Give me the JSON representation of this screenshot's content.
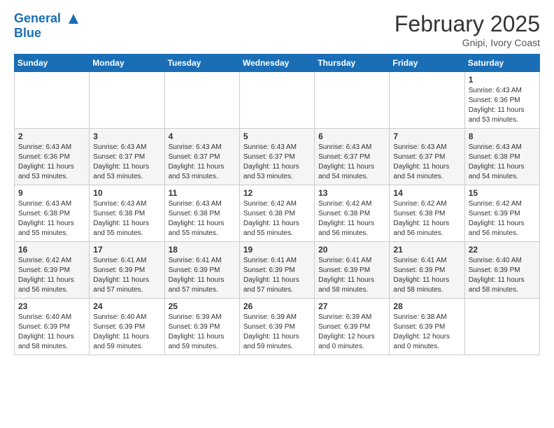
{
  "header": {
    "logo_line1": "General",
    "logo_line2": "Blue",
    "month_title": "February 2025",
    "location": "Gnipi, Ivory Coast"
  },
  "days_of_week": [
    "Sunday",
    "Monday",
    "Tuesday",
    "Wednesday",
    "Thursday",
    "Friday",
    "Saturday"
  ],
  "weeks": [
    [
      {
        "day": "",
        "info": ""
      },
      {
        "day": "",
        "info": ""
      },
      {
        "day": "",
        "info": ""
      },
      {
        "day": "",
        "info": ""
      },
      {
        "day": "",
        "info": ""
      },
      {
        "day": "",
        "info": ""
      },
      {
        "day": "1",
        "info": "Sunrise: 6:43 AM\nSunset: 6:36 PM\nDaylight: 11 hours\nand 53 minutes."
      }
    ],
    [
      {
        "day": "2",
        "info": "Sunrise: 6:43 AM\nSunset: 6:36 PM\nDaylight: 11 hours\nand 53 minutes."
      },
      {
        "day": "3",
        "info": "Sunrise: 6:43 AM\nSunset: 6:37 PM\nDaylight: 11 hours\nand 53 minutes."
      },
      {
        "day": "4",
        "info": "Sunrise: 6:43 AM\nSunset: 6:37 PM\nDaylight: 11 hours\nand 53 minutes."
      },
      {
        "day": "5",
        "info": "Sunrise: 6:43 AM\nSunset: 6:37 PM\nDaylight: 11 hours\nand 53 minutes."
      },
      {
        "day": "6",
        "info": "Sunrise: 6:43 AM\nSunset: 6:37 PM\nDaylight: 11 hours\nand 54 minutes."
      },
      {
        "day": "7",
        "info": "Sunrise: 6:43 AM\nSunset: 6:37 PM\nDaylight: 11 hours\nand 54 minutes."
      },
      {
        "day": "8",
        "info": "Sunrise: 6:43 AM\nSunset: 6:38 PM\nDaylight: 11 hours\nand 54 minutes."
      }
    ],
    [
      {
        "day": "9",
        "info": "Sunrise: 6:43 AM\nSunset: 6:38 PM\nDaylight: 11 hours\nand 55 minutes."
      },
      {
        "day": "10",
        "info": "Sunrise: 6:43 AM\nSunset: 6:38 PM\nDaylight: 11 hours\nand 55 minutes."
      },
      {
        "day": "11",
        "info": "Sunrise: 6:43 AM\nSunset: 6:38 PM\nDaylight: 11 hours\nand 55 minutes."
      },
      {
        "day": "12",
        "info": "Sunrise: 6:42 AM\nSunset: 6:38 PM\nDaylight: 11 hours\nand 55 minutes."
      },
      {
        "day": "13",
        "info": "Sunrise: 6:42 AM\nSunset: 6:38 PM\nDaylight: 11 hours\nand 56 minutes."
      },
      {
        "day": "14",
        "info": "Sunrise: 6:42 AM\nSunset: 6:38 PM\nDaylight: 11 hours\nand 56 minutes."
      },
      {
        "day": "15",
        "info": "Sunrise: 6:42 AM\nSunset: 6:39 PM\nDaylight: 11 hours\nand 56 minutes."
      }
    ],
    [
      {
        "day": "16",
        "info": "Sunrise: 6:42 AM\nSunset: 6:39 PM\nDaylight: 11 hours\nand 56 minutes."
      },
      {
        "day": "17",
        "info": "Sunrise: 6:41 AM\nSunset: 6:39 PM\nDaylight: 11 hours\nand 57 minutes."
      },
      {
        "day": "18",
        "info": "Sunrise: 6:41 AM\nSunset: 6:39 PM\nDaylight: 11 hours\nand 57 minutes."
      },
      {
        "day": "19",
        "info": "Sunrise: 6:41 AM\nSunset: 6:39 PM\nDaylight: 11 hours\nand 57 minutes."
      },
      {
        "day": "20",
        "info": "Sunrise: 6:41 AM\nSunset: 6:39 PM\nDaylight: 11 hours\nand 58 minutes."
      },
      {
        "day": "21",
        "info": "Sunrise: 6:41 AM\nSunset: 6:39 PM\nDaylight: 11 hours\nand 58 minutes."
      },
      {
        "day": "22",
        "info": "Sunrise: 6:40 AM\nSunset: 6:39 PM\nDaylight: 11 hours\nand 58 minutes."
      }
    ],
    [
      {
        "day": "23",
        "info": "Sunrise: 6:40 AM\nSunset: 6:39 PM\nDaylight: 11 hours\nand 58 minutes."
      },
      {
        "day": "24",
        "info": "Sunrise: 6:40 AM\nSunset: 6:39 PM\nDaylight: 11 hours\nand 59 minutes."
      },
      {
        "day": "25",
        "info": "Sunrise: 6:39 AM\nSunset: 6:39 PM\nDaylight: 11 hours\nand 59 minutes."
      },
      {
        "day": "26",
        "info": "Sunrise: 6:39 AM\nSunset: 6:39 PM\nDaylight: 11 hours\nand 59 minutes."
      },
      {
        "day": "27",
        "info": "Sunrise: 6:39 AM\nSunset: 6:39 PM\nDaylight: 12 hours\nand 0 minutes."
      },
      {
        "day": "28",
        "info": "Sunrise: 6:38 AM\nSunset: 6:39 PM\nDaylight: 12 hours\nand 0 minutes."
      },
      {
        "day": "",
        "info": ""
      }
    ]
  ]
}
